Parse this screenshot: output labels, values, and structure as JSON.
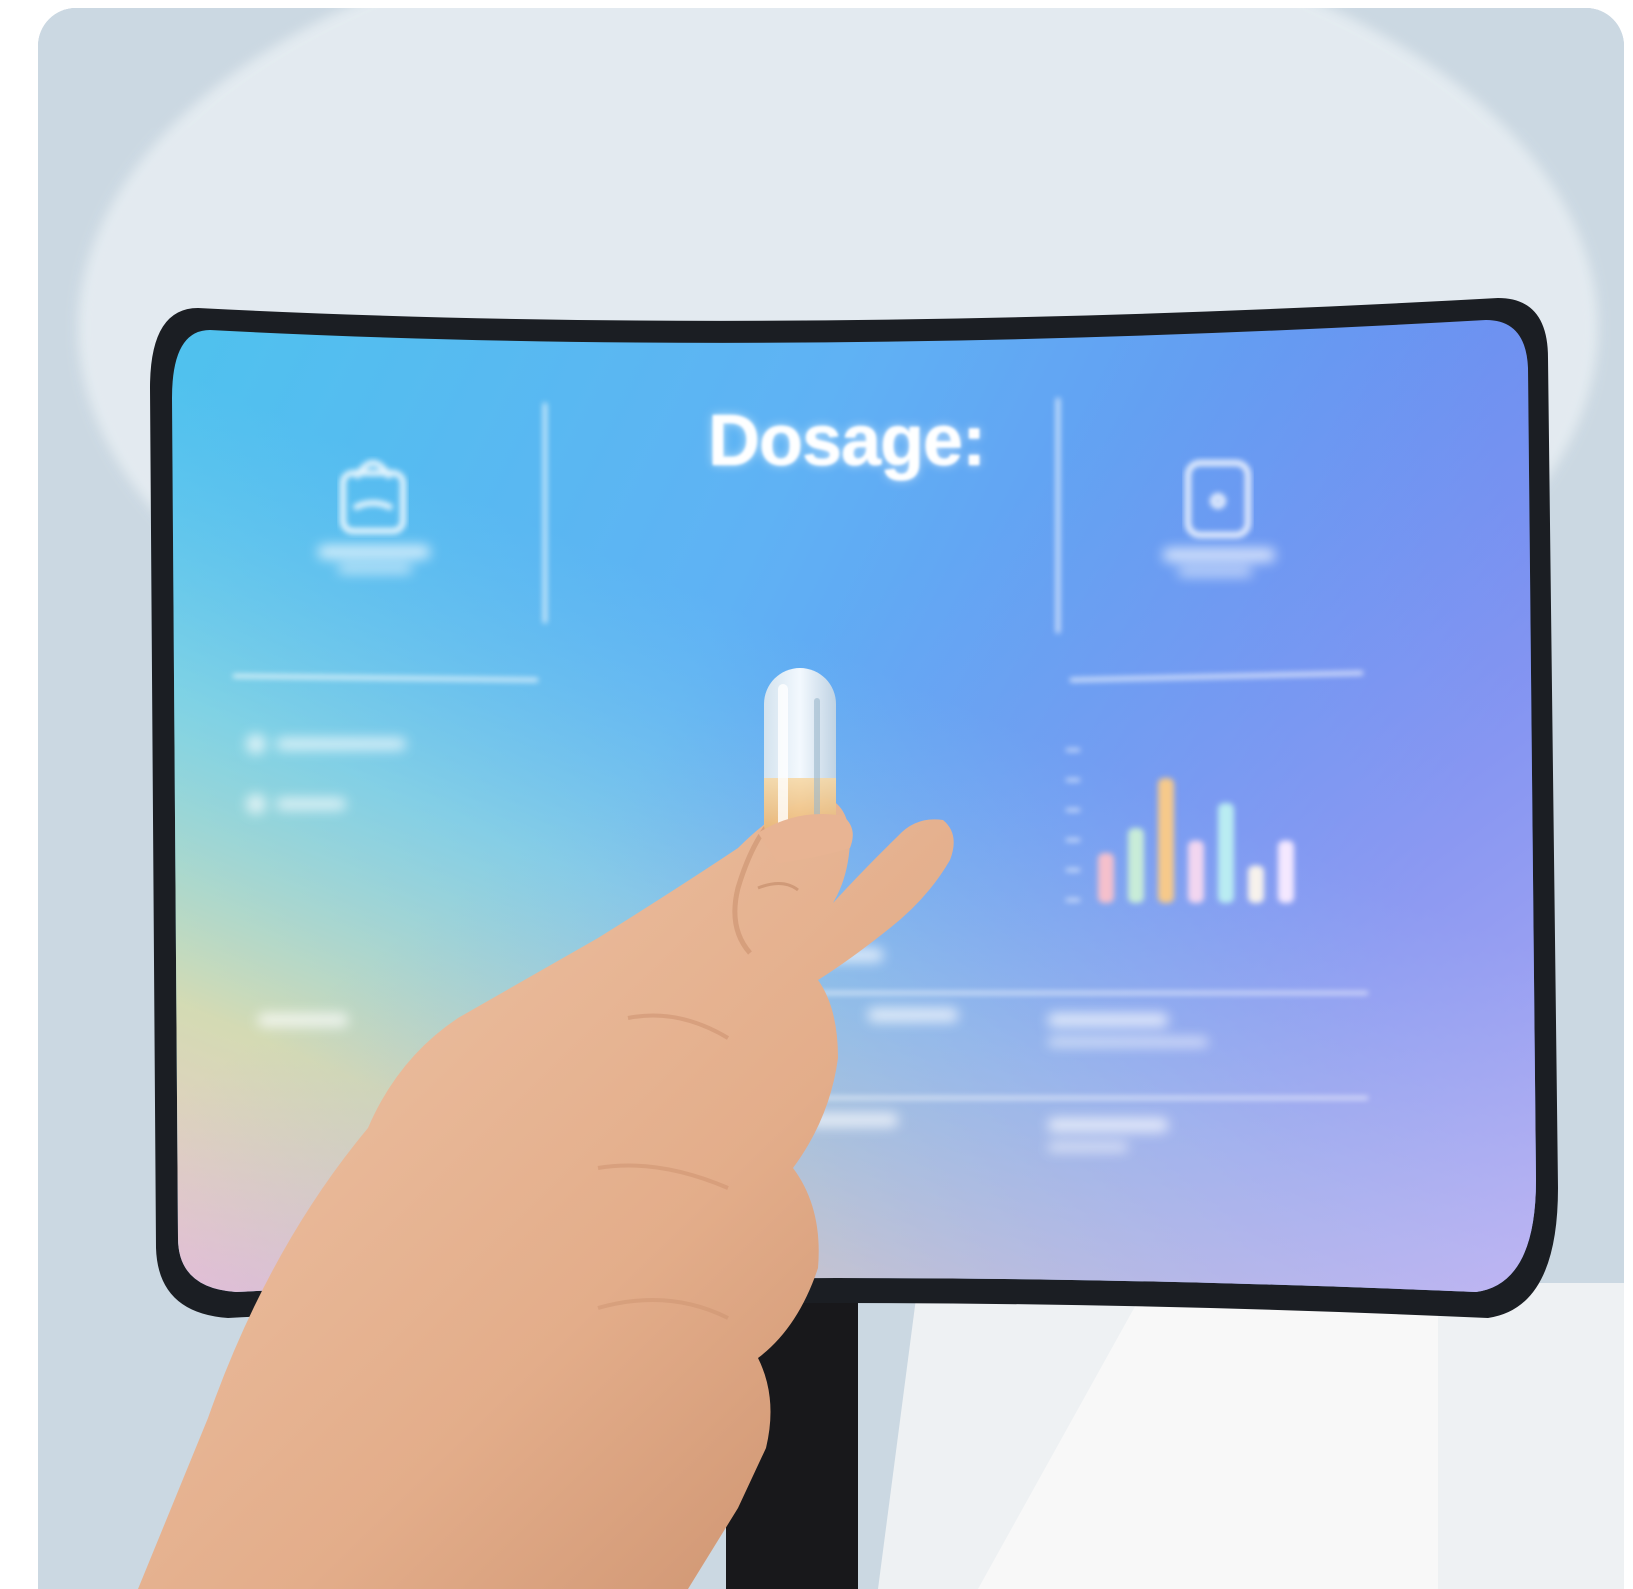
{
  "screen": {
    "title": "Dosage:"
  },
  "chart_data": {
    "type": "bar",
    "series": [
      {
        "values": [
          2,
          3,
          5,
          2.5,
          4,
          1.5,
          2.5
        ]
      }
    ],
    "colors": [
      "#f5c0cc",
      "#c8ecd8",
      "#f6c98a",
      "#f2d6f0",
      "#b9ecf2",
      "#f7f2ec",
      "#f4e8ff"
    ],
    "ylim": [
      0,
      6
    ],
    "grid": false
  },
  "colors": {
    "background": "#c9d7e1",
    "screen_bezel": "#1c1f24",
    "screen_gradient_start": "#5fc3ee",
    "screen_gradient_end": "#6f84f0",
    "stand": "#1a1a1d",
    "skin": "#e9b898"
  },
  "icons": {
    "left_panel": "shopping-bag-icon",
    "right_panel": "phone-icon"
  }
}
